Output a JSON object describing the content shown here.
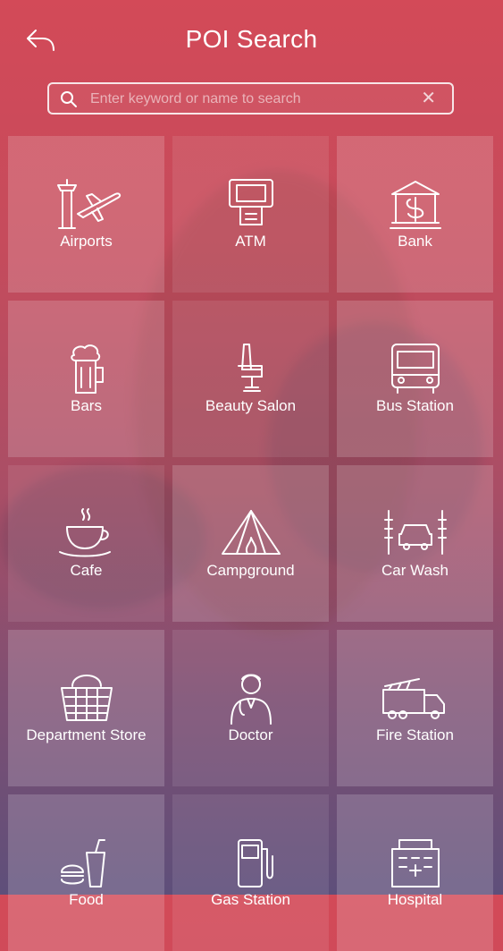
{
  "header": {
    "title": "POI Search"
  },
  "search": {
    "placeholder": "Enter keyword or name to search",
    "value": ""
  },
  "colors": {
    "gradient_top": "#d34a58",
    "gradient_bottom": "#5e4f7a",
    "text": "#ffffff"
  },
  "categories": [
    {
      "label": "Airports",
      "icon": "airport-icon"
    },
    {
      "label": "ATM",
      "icon": "atm-icon"
    },
    {
      "label": "Bank",
      "icon": "bank-icon"
    },
    {
      "label": "Bars",
      "icon": "beer-mug-icon"
    },
    {
      "label": "Beauty Salon",
      "icon": "salon-chair-icon"
    },
    {
      "label": "Bus Station",
      "icon": "bus-icon"
    },
    {
      "label": "Cafe",
      "icon": "coffee-cup-icon"
    },
    {
      "label": "Campground",
      "icon": "tent-icon"
    },
    {
      "label": "Car Wash",
      "icon": "car-wash-icon"
    },
    {
      "label": "Department Store",
      "icon": "shopping-basket-icon"
    },
    {
      "label": "Doctor",
      "icon": "doctor-icon"
    },
    {
      "label": "Fire Station",
      "icon": "fire-truck-icon"
    },
    {
      "label": "Food",
      "icon": "fast-food-icon"
    },
    {
      "label": "Gas Station",
      "icon": "gas-pump-icon"
    },
    {
      "label": "Hospital",
      "icon": "hospital-icon"
    }
  ]
}
